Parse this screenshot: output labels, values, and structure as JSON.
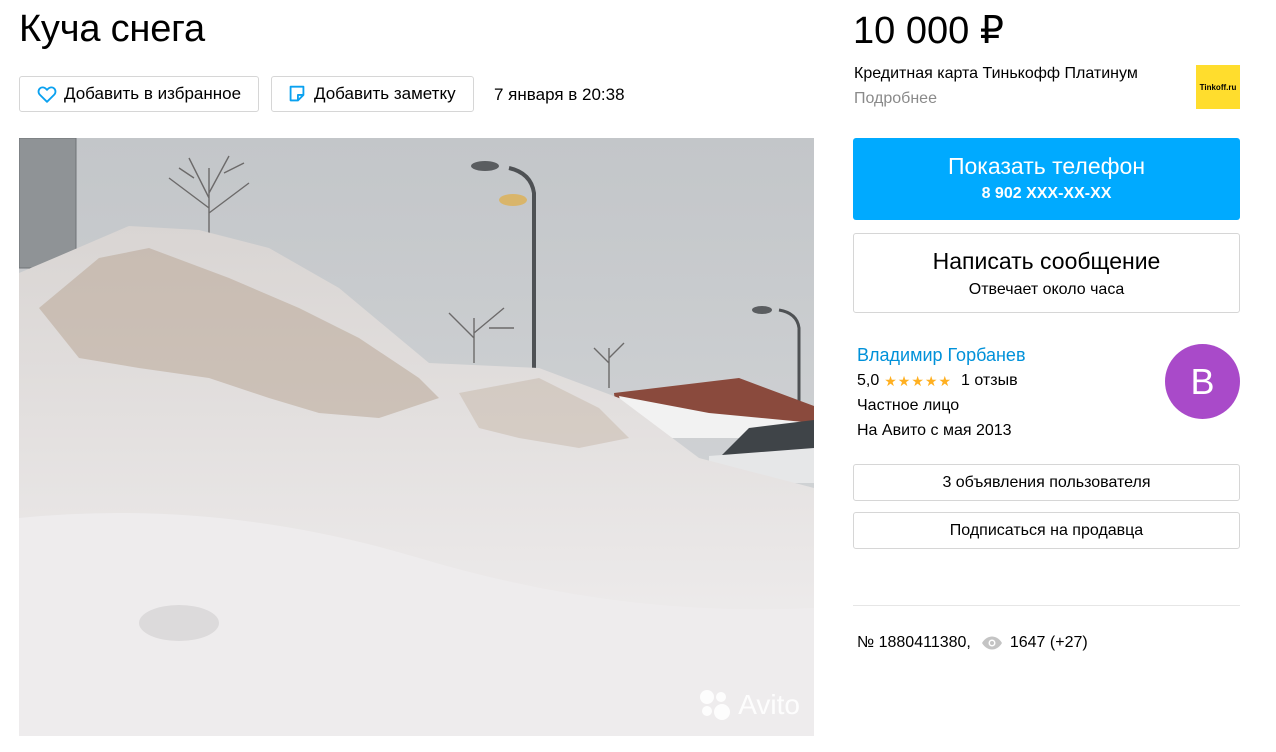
{
  "listing": {
    "title": "Куча снега",
    "price": "10 000 ₽",
    "date": "7 января в 20:38",
    "number": "№ 1880411380,",
    "views": "1647 (+27)"
  },
  "actions": {
    "favorite_label": "Добавить в избранное",
    "note_label": "Добавить заметку"
  },
  "ad": {
    "text": "Кредитная карта Тинькофф Платинум",
    "more": "Подробнее",
    "logo_text": "Tinkoff.ru",
    "logo_color": "#ffdd2d"
  },
  "contact": {
    "phone_title": "Показать телефон",
    "phone_number": "8 902 XXX-XX-XX",
    "message_title": "Написать сообщение",
    "message_subtitle": "Отвечает около часа",
    "accent_color": "#00aaff"
  },
  "seller": {
    "name": "Владимир Горбанев",
    "rating": "5,0",
    "stars": "★★★★★",
    "reviews": "1 отзыв",
    "type": "Частное лицо",
    "since": "На Авито с мая 2013",
    "avatar_letter": "В",
    "avatar_color": "#a94ac9",
    "ads_button": "3 объявления пользователя",
    "subscribe_button": "Подписаться на продавца"
  },
  "photo": {
    "watermark": "Avito",
    "icon": "snow-pile-photo"
  }
}
